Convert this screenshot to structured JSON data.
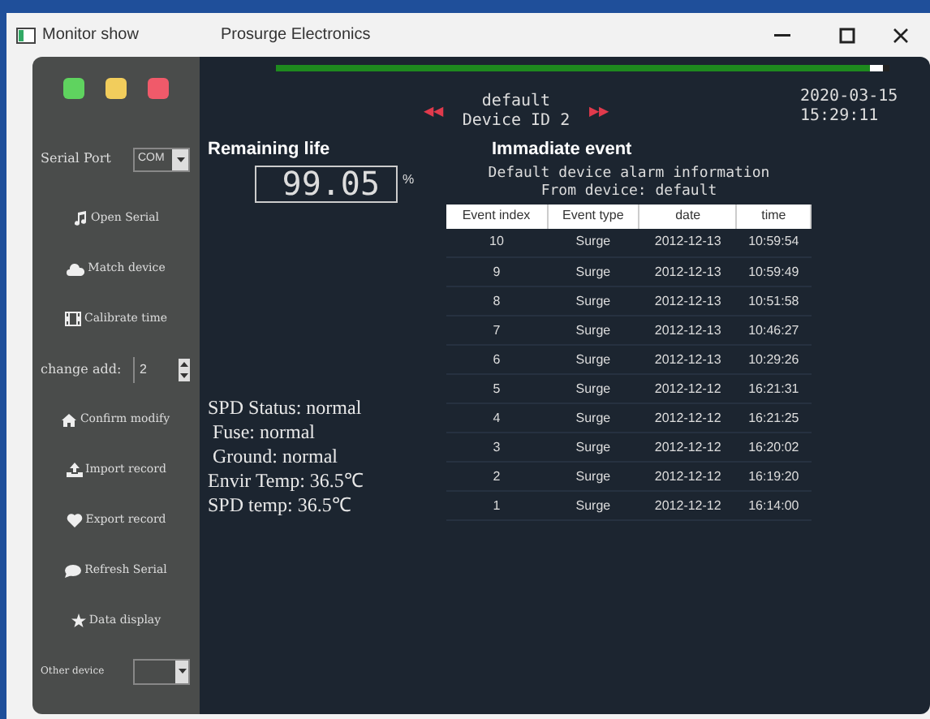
{
  "window": {
    "title": "Monitor show",
    "subtitle": "Prosurge Electronics"
  },
  "progress": {
    "level": 0.99
  },
  "traffic_lights": [
    {
      "color": "#5fd35f"
    },
    {
      "color": "#f2cd5c"
    },
    {
      "color": "#f05a6a"
    }
  ],
  "sidebar": {
    "serial_port": {
      "label": "Serial Port",
      "value": "COM"
    },
    "items": [
      {
        "kind": "button",
        "label": "Open Serial"
      },
      {
        "kind": "button",
        "label": "Match device"
      },
      {
        "kind": "button",
        "label": "Calibrate time"
      },
      {
        "kind": "spin",
        "label": "change add:",
        "value": "2"
      },
      {
        "kind": "button",
        "label": "Confirm modify"
      },
      {
        "kind": "button",
        "label": "Import record"
      },
      {
        "kind": "button",
        "label": "Export record"
      },
      {
        "kind": "button",
        "label": "Refresh Serial"
      },
      {
        "kind": "button",
        "label": "Data display"
      },
      {
        "kind": "select",
        "label": "Other device"
      }
    ]
  },
  "device": {
    "prev": "◀◀",
    "name": "default",
    "id": "Device ID 2",
    "next": "▶▶"
  },
  "clock": {
    "date": "2020-03-15",
    "time": "15:29:11"
  },
  "remaining_life": {
    "title": "Remaining life",
    "value": "99.05",
    "unit": "%"
  },
  "status_lines": [
    "SPD Status: normal",
    " Fuse: normal",
    " Ground: normal",
    "Envir Temp: 36.5℃",
    "SPD temp: 36.5℃"
  ],
  "events": {
    "title": "Immadiate event",
    "info": [
      "Default device alarm information",
      "From device: default"
    ],
    "table": {
      "columns": [
        "Event index",
        "Event type",
        "date",
        "time"
      ],
      "rows": [
        [
          "10",
          "Surge",
          "2012-12-13",
          "10:59:54"
        ],
        [
          "9",
          "Surge",
          "2012-12-13",
          "10:59:49"
        ],
        [
          "8",
          "Surge",
          "2012-12-13",
          "10:51:58"
        ],
        [
          "7",
          "Surge",
          "2012-12-13",
          "10:46:27"
        ],
        [
          "6",
          "Surge",
          "2012-12-13",
          "10:29:26"
        ],
        [
          "5",
          "Surge",
          "2012-12-12",
          "16:21:31"
        ],
        [
          "4",
          "Surge",
          "2012-12-12",
          "16:21:25"
        ],
        [
          "3",
          "Surge",
          "2012-12-12",
          "16:20:02"
        ],
        [
          "2",
          "Surge",
          "2012-12-12",
          "16:19:20"
        ],
        [
          "1",
          "Surge",
          "2012-12-12",
          "16:14:00"
        ]
      ]
    }
  }
}
